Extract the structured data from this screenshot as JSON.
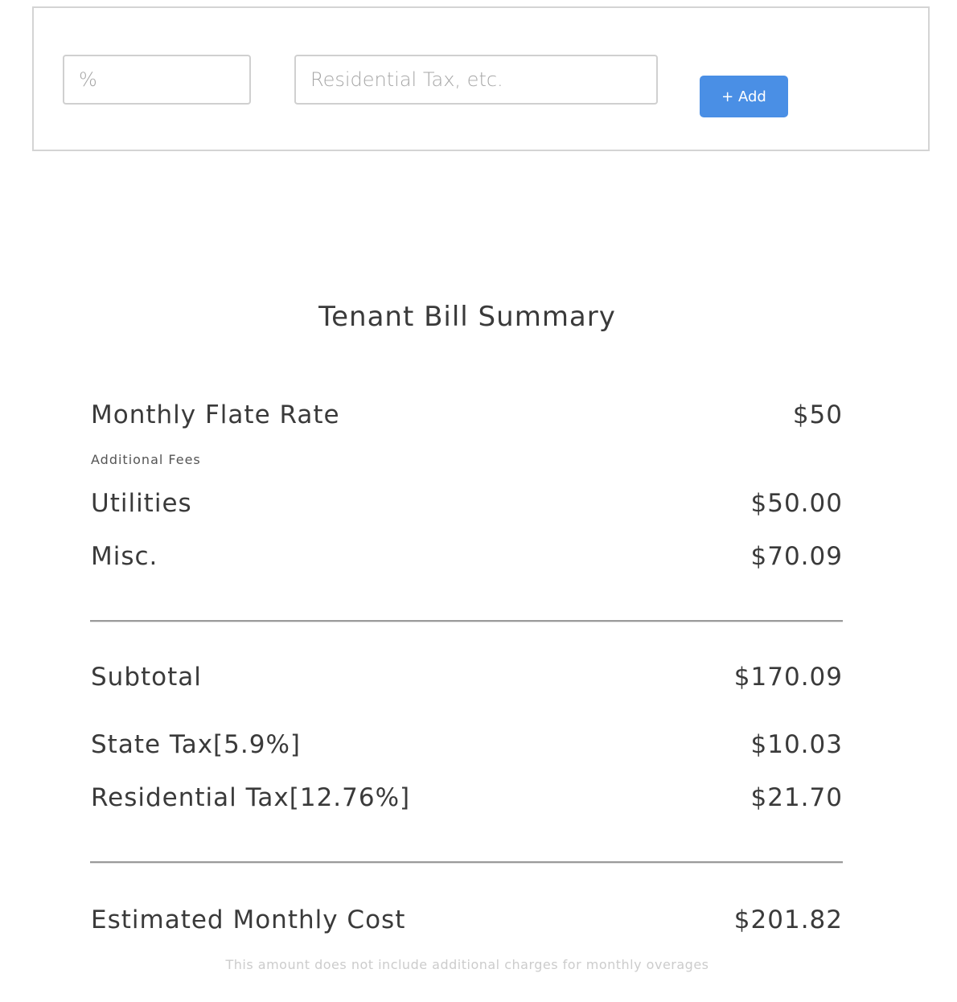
{
  "add_form": {
    "percent_placeholder": "%",
    "name_placeholder": "Residential Tax, etc.",
    "add_label": "+ Add",
    "accent_color": "#4a8fe5"
  },
  "summary": {
    "title": "Tenant Bill Summary",
    "flat_rate": {
      "label": "Monthly Flate Rate",
      "value": "$50"
    },
    "additional_fees_label": "Additional Fees",
    "fees": [
      {
        "label": "Utilities",
        "value": "$50.00"
      },
      {
        "label": "Misc.",
        "value": "$70.09"
      }
    ],
    "subtotal": {
      "label": "Subtotal",
      "value": "$170.09"
    },
    "taxes": [
      {
        "label": "State Tax[5.9%]",
        "value": "$10.03"
      },
      {
        "label": "Residential Tax[12.76%]",
        "value": "$21.70"
      }
    ],
    "total": {
      "label": "Estimated Monthly Cost",
      "value": "$201.82"
    },
    "disclaimer": "This amount does not include additional charges for monthly overages"
  }
}
